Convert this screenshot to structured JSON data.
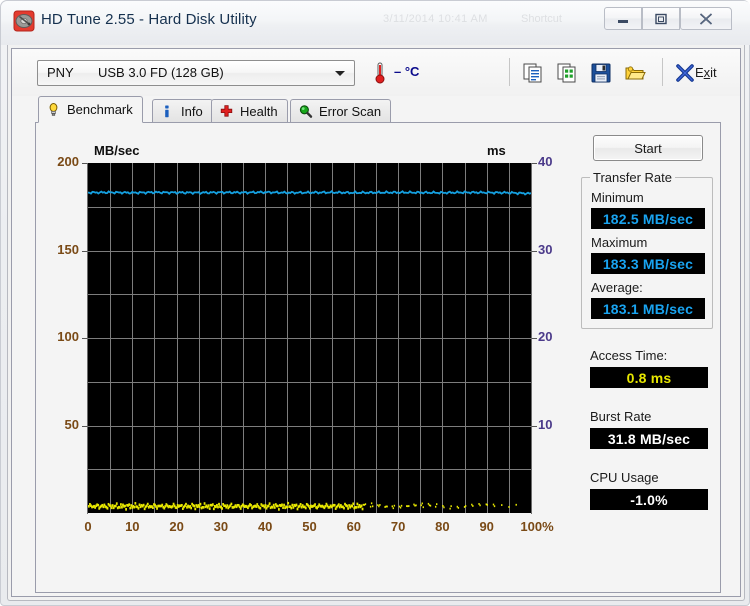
{
  "window": {
    "title": "HD Tune 2.55 - Hard Disk Utility",
    "ghost_timestamp": "3/11/2014 10:41 AM",
    "ghost_label": "Shortcut",
    "app_icon": "hard-disk-icon",
    "minimize_icon": "minimize-icon",
    "maximize_icon": "maximize-icon",
    "close_icon": "close-icon"
  },
  "toolbar": {
    "drive_vendor": "PNY",
    "drive_model": "USB 3.0 FD (128 GB)",
    "dropdown_icon": "chevron-down-icon",
    "temperature_icon": "thermometer-icon",
    "temperature_value": "– °C",
    "copy_text_icon": "copy-text-icon",
    "copy_image_icon": "copy-image-icon",
    "save_icon": "save-floppy-icon",
    "folder_icon": "folder-open-icon",
    "exit_icon": "close-x-icon",
    "exit_label_pre": "E",
    "exit_label_accel": "x",
    "exit_label_post": "it"
  },
  "tabs": [
    {
      "label": "Benchmark",
      "icon": "lightbulb-icon",
      "active": true
    },
    {
      "label": "Info",
      "icon": "info-icon",
      "active": false
    },
    {
      "label": "Health",
      "icon": "red-cross-icon",
      "active": false
    },
    {
      "label": "Error Scan",
      "icon": "magnifier-icon",
      "active": false
    }
  ],
  "sidebar": {
    "start_label": "Start",
    "transfer_rate": {
      "group_title": "Transfer Rate",
      "minimum_label": "Minimum",
      "minimum_value": "182.5 MB/sec",
      "maximum_label": "Maximum",
      "maximum_value": "183.3 MB/sec",
      "average_label": "Average:",
      "average_value": "183.1 MB/sec"
    },
    "access_time_label": "Access Time:",
    "access_time_value": "0.8 ms",
    "burst_rate_label": "Burst Rate",
    "burst_rate_value": "31.8 MB/sec",
    "cpu_usage_label": "CPU Usage",
    "cpu_usage_value": "-1.0%"
  },
  "colors": {
    "transfer_rate_line": "#15a0e0",
    "access_time_dots": "#e8e800",
    "lcd_background": "#000000",
    "lcd_blue_text": "#19a3f0",
    "lcd_yellow_text": "#e8e800",
    "lcd_white_text": "#ffffff",
    "plot_background": "#000000",
    "grid_line": "#7d7d7d",
    "left_axis_label": "#7a4a16",
    "right_axis_label": "#4b3a8a"
  },
  "chart_data": {
    "type": "line",
    "title": "",
    "xlabel": "",
    "ylabel": "MB/sec",
    "y2label": "ms",
    "xlim": [
      0,
      100
    ],
    "ylim": [
      0,
      200
    ],
    "y2lim": [
      0,
      40
    ],
    "grid": true,
    "legend_position": "none",
    "xticks": [
      0,
      10,
      20,
      30,
      40,
      50,
      60,
      70,
      80,
      90,
      100
    ],
    "xticklabels": [
      "0",
      "10",
      "20",
      "30",
      "40",
      "50",
      "60",
      "70",
      "80",
      "90",
      "100%"
    ],
    "yticks": [
      50,
      100,
      150,
      200
    ],
    "yticklabels": [
      "50",
      "100",
      "150",
      "200"
    ],
    "y2ticks": [
      10,
      20,
      30,
      40
    ],
    "y2ticklabels": [
      "10",
      "20",
      "30",
      "40"
    ],
    "series": [
      {
        "name": "Transfer rate",
        "axis": "left",
        "unit": "MB/sec",
        "color": "#15a0e0",
        "x": [
          0,
          5,
          10,
          15,
          20,
          25,
          30,
          35,
          40,
          45,
          50,
          55,
          60,
          65,
          70,
          75,
          80,
          85,
          90,
          95,
          100
        ],
        "values": [
          183.1,
          183.2,
          183.0,
          183.2,
          183.1,
          183.0,
          183.2,
          183.1,
          183.3,
          183.0,
          183.1,
          183.2,
          183.0,
          183.1,
          183.2,
          183.1,
          183.0,
          183.2,
          183.1,
          183.0,
          182.5
        ]
      },
      {
        "name": "Access time",
        "axis": "right",
        "unit": "ms",
        "color": "#e8e800",
        "marker": "dots",
        "x": [
          0,
          5,
          10,
          15,
          20,
          25,
          30,
          35,
          40,
          45,
          50,
          55,
          60,
          65,
          70,
          75,
          80,
          85,
          90,
          95,
          100
        ],
        "values": [
          0.8,
          0.8,
          0.8,
          0.8,
          0.8,
          0.8,
          0.8,
          0.8,
          0.8,
          0.8,
          0.8,
          0.8,
          0.8,
          0.8,
          0.8,
          0.8,
          0.8,
          0.8,
          0.8,
          0.8,
          0.8
        ]
      }
    ]
  }
}
